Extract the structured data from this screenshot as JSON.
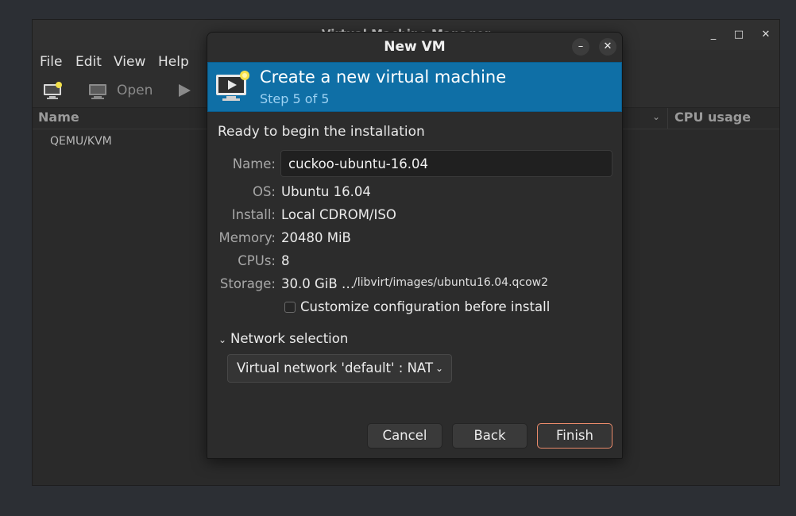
{
  "main_window": {
    "title": "Virtual Machine Manager",
    "controls": {
      "minimize": "_",
      "maximize": "□",
      "close": "✕"
    },
    "menu": [
      "File",
      "Edit",
      "View",
      "Help"
    ],
    "toolbar": {
      "open_label": "Open"
    },
    "columns": {
      "name": "Name",
      "cpu": "CPU usage"
    },
    "rows": [
      "QEMU/KVM"
    ]
  },
  "dialog": {
    "title": "New VM",
    "controls": {
      "minimize": "–",
      "close": "✕"
    },
    "banner": {
      "title": "Create a new virtual machine",
      "step": "Step 5 of 5"
    },
    "ready_text": "Ready to begin the installation",
    "fields": {
      "name_label": "Name:",
      "name_value": "cuckoo-ubuntu-16.04",
      "os_label": "OS:",
      "os_value": "Ubuntu 16.04",
      "install_label": "Install:",
      "install_value": "Local CDROM/ISO",
      "memory_label": "Memory:",
      "memory_value": "20480 MiB",
      "cpus_label": "CPUs:",
      "cpus_value": "8",
      "storage_label": "Storage:",
      "storage_value": "30.0 GiB …",
      "storage_path": "/libvirt/images/ubuntu16.04.qcow2"
    },
    "customize_label": "Customize configuration before install",
    "customize_checked": false,
    "network": {
      "section_label": "Network selection",
      "selected": "Virtual network 'default' : NAT"
    },
    "buttons": {
      "cancel": "Cancel",
      "back": "Back",
      "finish": "Finish"
    },
    "colors": {
      "banner": "#0f6fa6",
      "finish_border": "#e98a6a"
    }
  }
}
